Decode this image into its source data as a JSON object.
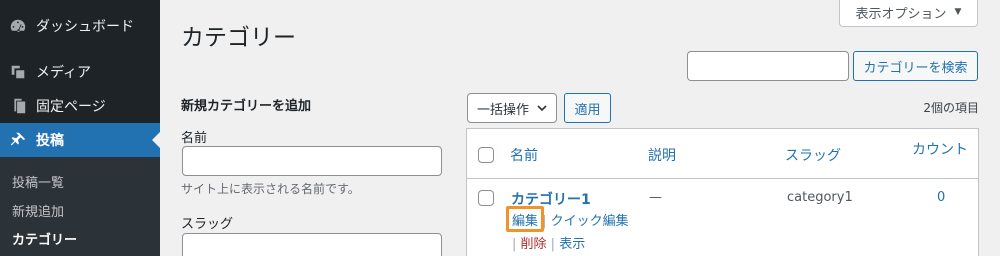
{
  "sidebar": {
    "items": [
      {
        "label": "ダッシュボード",
        "icon": "dashboard-icon"
      },
      {
        "label": "メディア",
        "icon": "media-icon"
      },
      {
        "label": "固定ページ",
        "icon": "page-icon"
      },
      {
        "label": "投稿",
        "icon": "pin-icon"
      }
    ],
    "submenu": [
      {
        "label": "投稿一覧"
      },
      {
        "label": "新規追加"
      },
      {
        "label": "カテゴリー"
      }
    ]
  },
  "header": {
    "screen_options": "表示オプション",
    "title": "カテゴリー"
  },
  "search": {
    "value": "",
    "button": "カテゴリーを検索"
  },
  "add_form": {
    "heading": "新規カテゴリーを追加",
    "name_label": "名前",
    "name_value": "",
    "name_description": "サイト上に表示される名前です。",
    "slug_label": "スラッグ",
    "slug_value": ""
  },
  "toolbar": {
    "bulk_action": "一括操作",
    "apply": "適用",
    "items_count": "2個の項目"
  },
  "table": {
    "columns": [
      "名前",
      "説明",
      "スラッグ",
      "カウント"
    ],
    "rows": [
      {
        "name": "カテゴリー1",
        "description": "—",
        "slug": "category1",
        "count": "0",
        "actions": [
          "編集",
          "クイック編集",
          "削除",
          "表示"
        ]
      }
    ]
  },
  "colors": {
    "sidebar_bg": "#1d2327",
    "accent": "#2271b1",
    "highlight": "#f0932b",
    "delete": "#b32d2e"
  }
}
